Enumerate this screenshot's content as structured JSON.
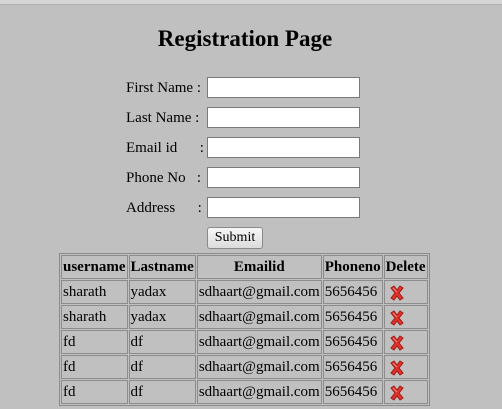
{
  "page_title": "Registration Page",
  "form": {
    "fields": [
      {
        "label": "First Name :",
        "value": ""
      },
      {
        "label": "Last Name :",
        "value": ""
      },
      {
        "label": "Email id      :",
        "value": ""
      },
      {
        "label": "Phone No   :",
        "value": ""
      },
      {
        "label": "Address      :",
        "value": ""
      }
    ],
    "submit_label": "Submit"
  },
  "table": {
    "headers": [
      "username",
      "Lastname",
      "Emailid",
      "Phoneno",
      "Delete"
    ],
    "rows": [
      {
        "username": "sharath",
        "lastname": "yadax",
        "email": "sdhaart@gmail.com",
        "phone": "5656456",
        "delete_icon": "red-x-icon"
      },
      {
        "username": "sharath",
        "lastname": "yadax",
        "email": "sdhaart@gmail.com",
        "phone": "5656456",
        "delete_icon": "red-x-icon"
      },
      {
        "username": "fd",
        "lastname": "df",
        "email": "sdhaart@gmail.com",
        "phone": "5656456",
        "delete_icon": "red-x-icon"
      },
      {
        "username": "fd",
        "lastname": "df",
        "email": "sdhaart@gmail.com",
        "phone": "5656456",
        "delete_icon": "red-x-icon"
      },
      {
        "username": "fd",
        "lastname": "df",
        "email": "sdhaart@gmail.com",
        "phone": "5656456",
        "delete_icon": "red-x-icon"
      }
    ]
  },
  "colors": {
    "background": "#c0c0c0",
    "delete_icon": "#e0322a"
  }
}
